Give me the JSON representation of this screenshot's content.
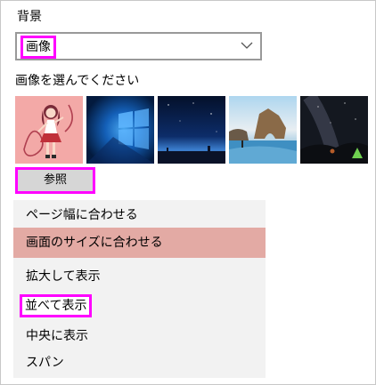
{
  "background": {
    "label": "背景",
    "dropdown_value": "画像"
  },
  "picture_picker": {
    "label": "画像を選んでください",
    "thumbnails": [
      {
        "icon": "anime-girl-thumbnail"
      },
      {
        "icon": "windows-hero-thumbnail"
      },
      {
        "icon": "night-sky-horizon-thumbnail"
      },
      {
        "icon": "beach-rock-arch-thumbnail"
      },
      {
        "icon": "milky-way-tent-thumbnail"
      }
    ],
    "browse_label": "参照"
  },
  "fit_menu": {
    "items": [
      {
        "label": "ページ幅に合わせる",
        "state": "normal"
      },
      {
        "label": "画面のサイズに合わせる",
        "state": "selected"
      },
      {
        "label": "拡大して表示",
        "state": "normal"
      },
      {
        "label": "並べて表示",
        "state": "highlighted"
      },
      {
        "label": "中央に表示",
        "state": "normal"
      },
      {
        "label": "スパン",
        "state": "normal"
      }
    ]
  },
  "colors": {
    "highlight_outline": "#ff00ff",
    "selected_item": "#e3aaa4",
    "menu_background": "#f2f2f2"
  }
}
